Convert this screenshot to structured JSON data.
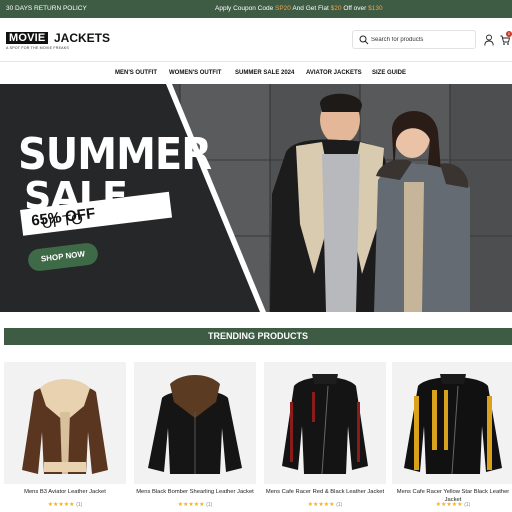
{
  "topbar": {
    "left": "30 DAYS RETURN POLICY",
    "coupon_prefix": "Apply Coupon Code ",
    "coupon_code": "SP20",
    "coupon_mid": " And Get Flat ",
    "coupon_amount": "$20",
    "coupon_suffix": " Off over ",
    "coupon_threshold": "$130"
  },
  "header": {
    "logo_word1": "MOVIE",
    "logo_word2": "JACKETS",
    "logo_tagline": "A SPOT FOR THE MOVIE FREAKS",
    "search_placeholder": "Search for products",
    "cart_count": "0"
  },
  "nav": [
    "MEN'S OUTFIT",
    "WOMEN'S OUTFIT",
    "SUMMER SALE 2024",
    "AVIATOR JACKETS",
    "SIZE GUIDE"
  ],
  "hero": {
    "line1": "SUMMER",
    "line2": "SALE",
    "upto": "UPTO ",
    "discount": "65% OFF",
    "cta": "SHOP NOW"
  },
  "trending": {
    "title": "TRENDING PRODUCTS",
    "products": [
      {
        "name": "Mens B3 Aviator Leather Jacket",
        "rating": "★★★★★",
        "reviews": "(1)"
      },
      {
        "name": "Mens Black Bomber Shearling Leather Jacket",
        "rating": "★★★★★",
        "reviews": "(1)"
      },
      {
        "name": "Mens Cafe Racer Red & Black Leather Jacket",
        "rating": "★★★★★",
        "reviews": "(1)"
      },
      {
        "name": "Mens Cafe Racer Yellow Star Black Leather Jacket",
        "rating": "★★★★★",
        "reviews": "(1)"
      }
    ]
  },
  "colors": {
    "brand_green": "#3e5b44",
    "accent_orange": "#f0a14a",
    "star_yellow": "#f3b312"
  }
}
